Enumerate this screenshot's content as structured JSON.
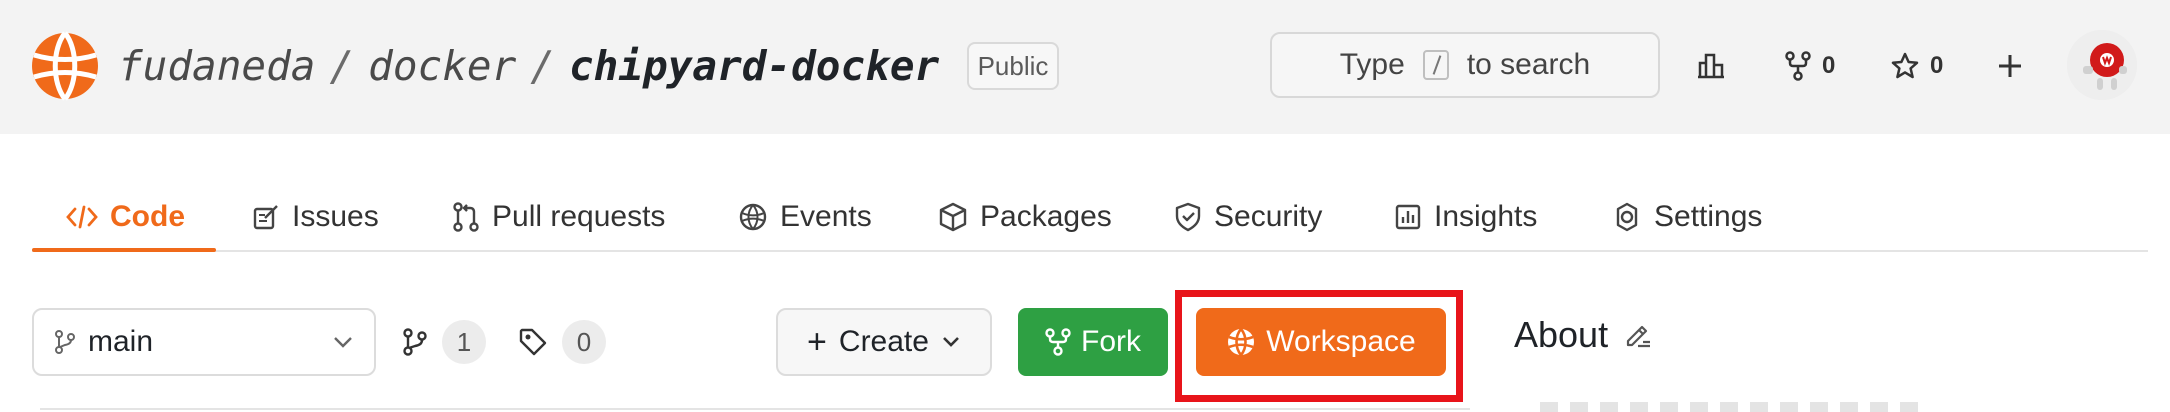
{
  "header": {
    "owner": "fudaneda",
    "group": "docker",
    "repo": "chipyard-docker",
    "separator": "/",
    "visibility": "Public",
    "search": {
      "prefix": "Type",
      "suffix": "to search",
      "shortcut_key": "/"
    },
    "forks_count": "0",
    "stars_count": "0",
    "icons": [
      "activity-icon",
      "fork-icon",
      "star-icon",
      "plus-icon"
    ]
  },
  "tabs": [
    {
      "label": "Code",
      "icon": "code-icon",
      "active": true
    },
    {
      "label": "Issues",
      "icon": "issue-icon"
    },
    {
      "label": "Pull requests",
      "icon": "pull-request-icon"
    },
    {
      "label": "Events",
      "icon": "events-icon"
    },
    {
      "label": "Packages",
      "icon": "package-icon"
    },
    {
      "label": "Security",
      "icon": "shield-icon"
    },
    {
      "label": "Insights",
      "icon": "graph-icon"
    },
    {
      "label": "Settings",
      "icon": "gear-icon"
    }
  ],
  "toolbar": {
    "branch": "main",
    "branches_count": "1",
    "tags_count": "0",
    "create_label": "Create",
    "fork_label": "Fork",
    "workspace_label": "Workspace"
  },
  "sidebar": {
    "about_title": "About"
  },
  "colors": {
    "accent": "#f06a1a",
    "fork_green": "#2ea043",
    "highlight_red": "#e8141a",
    "header_bg": "#f3f3f3"
  }
}
